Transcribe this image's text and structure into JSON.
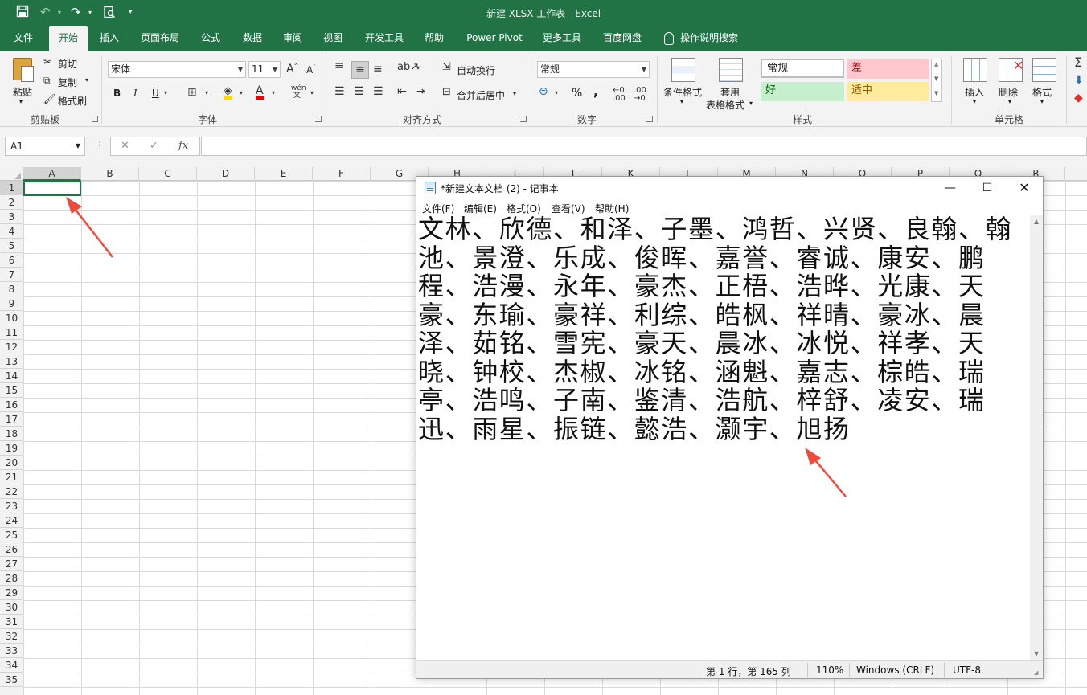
{
  "excel": {
    "title": "新建 XLSX 工作表  -  Excel",
    "tabs": [
      "文件",
      "开始",
      "插入",
      "页面布局",
      "公式",
      "数据",
      "审阅",
      "视图",
      "开发工具",
      "帮助",
      "Power Pivot",
      "更多工具",
      "百度网盘",
      "操作说明搜索"
    ],
    "active_tab": "开始",
    "clipboard": {
      "paste": "粘贴",
      "cut": "剪切",
      "copy": "复制",
      "format_painter": "格式刷",
      "label": "剪贴板"
    },
    "font": {
      "name": "宋体",
      "size": "11",
      "label": "字体",
      "bold": "B",
      "italic": "I",
      "underline": "U"
    },
    "alignment": {
      "wrap": "自动换行",
      "merge": "合并后居中",
      "label": "对齐方式"
    },
    "number": {
      "format": "常规",
      "percent": "%",
      "comma": ",",
      "label": "数字"
    },
    "styles": {
      "conditional": "条件格式",
      "table1": "套用",
      "table2": "表格格式",
      "normal": "常规",
      "bad": "差",
      "good": "好",
      "neutral": "适中",
      "label": "样式"
    },
    "cells": {
      "insert": "插入",
      "delete": "删除",
      "format": "格式",
      "label": "单元格"
    },
    "name_box": "A1",
    "fx": "fx",
    "columns": [
      "A",
      "B",
      "C",
      "D",
      "E",
      "F",
      "G",
      "H",
      "I",
      "J",
      "K",
      "L",
      "M",
      "N",
      "O",
      "P",
      "Q",
      "R"
    ],
    "rows": [
      "1",
      "2",
      "3",
      "4",
      "5",
      "6",
      "7",
      "8",
      "9",
      "10",
      "11",
      "12",
      "13",
      "14",
      "15",
      "16",
      "17",
      "18",
      "19",
      "20",
      "21",
      "22",
      "23",
      "24",
      "25",
      "26",
      "27",
      "28",
      "29",
      "30",
      "31",
      "32",
      "33",
      "34",
      "35"
    ],
    "colors": {
      "accent": "#217346",
      "bad_bg": "#ffc7ce",
      "bad_fg": "#9c0006",
      "good_bg": "#c6efce",
      "good_fg": "#006100",
      "neutral_bg": "#ffeb9c",
      "neutral_fg": "#9c5700"
    }
  },
  "notepad": {
    "title": "*新建文本文档 (2) - 记事本",
    "menu": [
      "文件(F)",
      "编辑(E)",
      "格式(O)",
      "查看(V)",
      "帮助(H)"
    ],
    "content": "文林、欣德、和泽、子墨、鸿哲、兴贤、良翰、翰池、景澄、乐成、俊晖、嘉誉、睿诚、康安、鹏程、浩漫、永年、豪杰、正梧、浩晔、光康、天豪、东瑜、豪祥、利综、皓枫、祥晴、豪冰、晨泽、茹铭、雪宪、豪天、晨冰、冰悦、祥孝、天晓、钟校、杰椒、冰铭、涵魁、嘉志、棕皓、瑞亭、浩鸣、子南、鉴清、浩航、梓舒、凌安、瑞迅、雨星、振链、懿浩、灏宇、旭扬",
    "status": {
      "position": "第 1 行，第 165 列",
      "zoom": "110%",
      "eol": "Windows (CRLF)",
      "encoding": "UTF-8"
    }
  }
}
